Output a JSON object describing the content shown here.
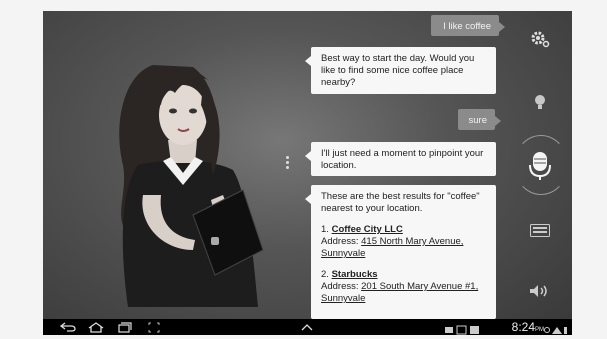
{
  "chat": {
    "user_msg_1": "I like coffee",
    "bot_msg_1": "Best way to start the day. Would you like to find some nice coffee place nearby?",
    "user_msg_2": "sure",
    "bot_msg_2": "I'll just need a moment to pinpoint your location.",
    "bot_msg_3_intro": "These are the best results for \"coffee\" nearest to your location.",
    "results": [
      {
        "index": "1.",
        "name": "Coffee City LLC",
        "address_label": "Address: ",
        "address": "415 North Mary Avenue, Sunnyvale"
      },
      {
        "index": "2.",
        "name": "Starbucks",
        "address_label": "Address: ",
        "address": "201 South Mary Avenue #1, Sunnyvale"
      }
    ]
  },
  "side_controls": [
    "settings-icon",
    "lightbulb-icon",
    "microphone-icon",
    "keyboard-icon",
    "speaker-icon"
  ],
  "status_bar": {
    "time": "8:24",
    "ampm": "PM"
  },
  "colors": {
    "user_bubble": "#8b8b8b",
    "bot_bubble": "#f7f7f7",
    "navbar": "#000000"
  }
}
